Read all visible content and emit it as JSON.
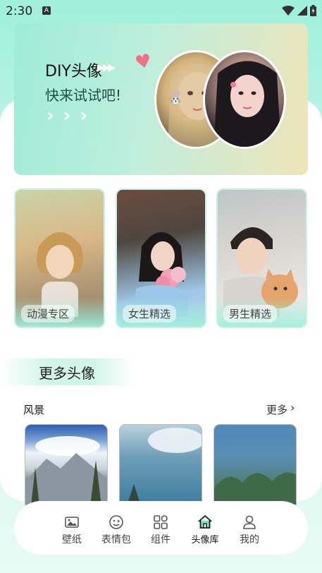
{
  "status_bar": {
    "time": "2:30",
    "notification_letter": "A"
  },
  "banner": {
    "title": "DIY头像",
    "subtitle": "快来试试吧!",
    "chevrons": "› › ›"
  },
  "categories": [
    {
      "label": "动漫专区"
    },
    {
      "label": "女生精选"
    },
    {
      "label": "男生精选"
    }
  ],
  "more_section": {
    "heading": "更多头像"
  },
  "scenery": {
    "title": "风景",
    "more_label": "更多"
  },
  "bottom_nav": {
    "items": [
      {
        "label": "壁纸",
        "icon": "image-icon",
        "active": false
      },
      {
        "label": "表情包",
        "icon": "smiley-icon",
        "active": false
      },
      {
        "label": "组件",
        "icon": "widget-grid-icon",
        "active": false
      },
      {
        "label": "头像库",
        "icon": "home-icon",
        "active": true
      },
      {
        "label": "我的",
        "icon": "user-icon",
        "active": false
      }
    ]
  },
  "colors": {
    "accent": "#1aa57f",
    "background_mint": "#9ff0dd"
  }
}
